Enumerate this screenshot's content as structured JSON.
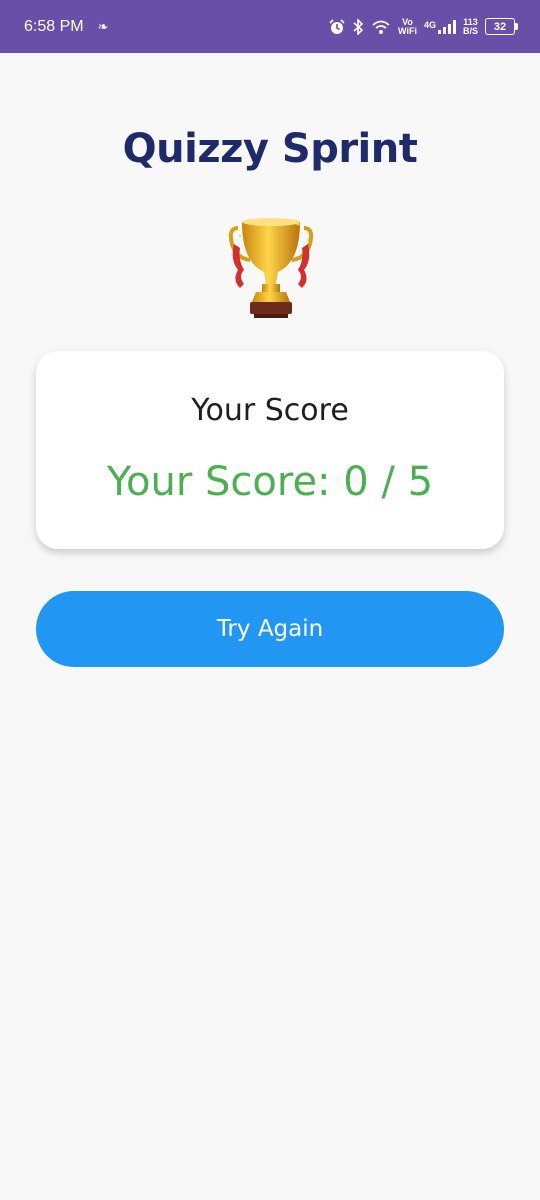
{
  "status_bar": {
    "time": "6:58 PM",
    "volte_top": "Vo",
    "volte_bottom": "WiFi",
    "network": "4G",
    "speed_top": "113",
    "speed_bottom": "B/S",
    "battery": "32",
    "icons": [
      "notification-icon",
      "alarm-icon",
      "bluetooth-icon",
      "wifi-icon",
      "signal-icon",
      "battery-icon"
    ]
  },
  "app": {
    "title": "Quizzy Sprint",
    "trophy_icon": "trophy-icon"
  },
  "score_card": {
    "heading": "Your Score",
    "value": "Your Score: 0 / 5"
  },
  "actions": {
    "try_again_label": "Try Again"
  },
  "colors": {
    "status_bar": "#6a4fa8",
    "title": "#1f2a6b",
    "score_value": "#4caf50",
    "button": "#2196f3",
    "background": "#f8f8f8"
  }
}
